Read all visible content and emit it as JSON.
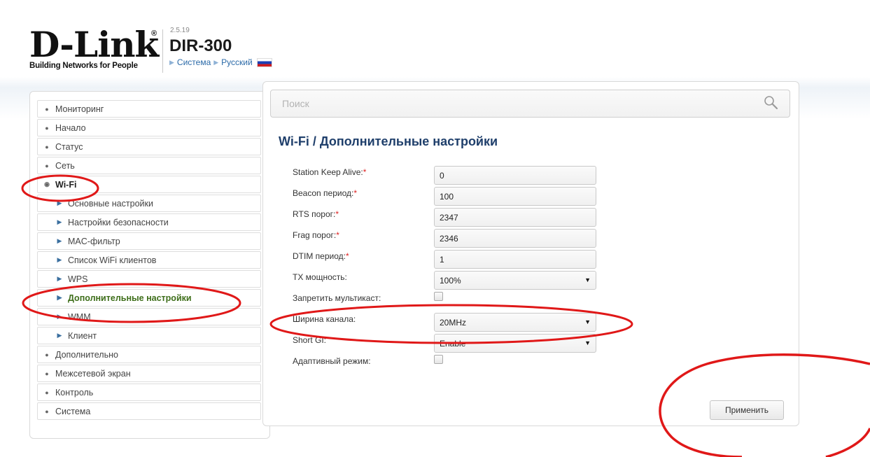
{
  "header": {
    "logo_main": "D-Link",
    "logo_reg": "®",
    "logo_tagline": "Building Networks for People",
    "version": "2.5.19",
    "model": "DIR-300",
    "crumb_system": "Система",
    "crumb_language": "Русский"
  },
  "sidebar": {
    "items": [
      {
        "label": "Мониторинг"
      },
      {
        "label": "Начало"
      },
      {
        "label": "Статус"
      },
      {
        "label": "Сеть"
      },
      {
        "label": "Wi-Fi"
      },
      {
        "label": "Основные настройки"
      },
      {
        "label": "Настройки безопасности"
      },
      {
        "label": "MAC-фильтр"
      },
      {
        "label": "Список WiFi клиентов"
      },
      {
        "label": "WPS"
      },
      {
        "label": "Дополнительные настройки"
      },
      {
        "label": "WMM"
      },
      {
        "label": "Клиент"
      },
      {
        "label": "Дополнительно"
      },
      {
        "label": "Межсетевой экран"
      },
      {
        "label": "Контроль"
      },
      {
        "label": "Система"
      }
    ]
  },
  "search": {
    "placeholder": "Поиск"
  },
  "page": {
    "title": "Wi-Fi /  Дополнительные настройки"
  },
  "form": {
    "station_keep_alive": {
      "label": "Station Keep Alive:",
      "value": "0"
    },
    "beacon": {
      "label": "Beacon период:",
      "value": "100"
    },
    "rts": {
      "label": "RTS порог:",
      "value": "2347"
    },
    "frag": {
      "label": "Frag порог:",
      "value": "2346"
    },
    "dtim": {
      "label": "DTIM период:",
      "value": "1"
    },
    "tx_power": {
      "label": "TX мощность:",
      "value": "100%"
    },
    "multicast": {
      "label": "Запретить мультикаст:"
    },
    "channel_width": {
      "label": "Ширина канала:",
      "value": "20MHz"
    },
    "short_gi": {
      "label": "Short GI:",
      "value": "Enable"
    },
    "adaptive": {
      "label": "Адаптивный режим:"
    },
    "required_mark": "*"
  },
  "apply_label": "Применить",
  "colors": {
    "annotation": "#e01818",
    "title": "#1f3f6b",
    "current_item": "#3e6e1a"
  }
}
